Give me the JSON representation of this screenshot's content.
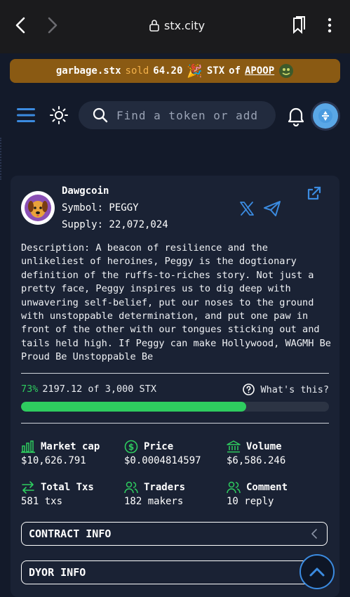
{
  "browser": {
    "url": "stx.city"
  },
  "ticker": {
    "user": "garbage.stx",
    "action": "sold",
    "amount": "64.20",
    "currency": "STX",
    "of_word": "of",
    "token": "APOOP"
  },
  "nav": {
    "search_placeholder": "Find a token or add:"
  },
  "token": {
    "name": "Dawgcoin",
    "symbol": "Symbol: PEGGY",
    "supply": "Supply: 22,072,024",
    "description": "Description: A beacon of resilience and the unlikeliest of heroines, Peggy is the dogtionary definition of the ruffs-to-riches story. Not just a pretty face, Peggy inspires us to dig deep with unwavering self-belief, put our noses to the ground with unstoppable determination, and put one paw in front of the other with our tongues sticking out and tails held high. If Peggy can make Hollywood, WAGMH Be Proud Be Unstoppable Be"
  },
  "progress": {
    "percent_label": "73%",
    "text": "2197.12 of 3,000 STX",
    "fraction": 0.732,
    "help_label": "What's this?",
    "color": "#2ecc5f"
  },
  "stats": {
    "market_cap": {
      "label": "Market cap",
      "value": "$10,626.791"
    },
    "price": {
      "label": "Price",
      "value": "$0.0004814597"
    },
    "volume": {
      "label": "Volume",
      "value": "$6,586.246"
    },
    "total_txs": {
      "label": "Total Txs",
      "value": "581 txs"
    },
    "traders": {
      "label": "Traders",
      "value": "182 makers"
    },
    "comment": {
      "label": "Comment",
      "value": "10 reply"
    }
  },
  "sections": {
    "contract_info": "CONTRACT INFO",
    "dyor_info": "DYOR INFO"
  },
  "colors": {
    "background": "#131a2a",
    "card": "#1a2234",
    "accent_blue": "#3b8be0",
    "ticker_bg": "#8a5a13",
    "green": "#2ecc5f"
  }
}
